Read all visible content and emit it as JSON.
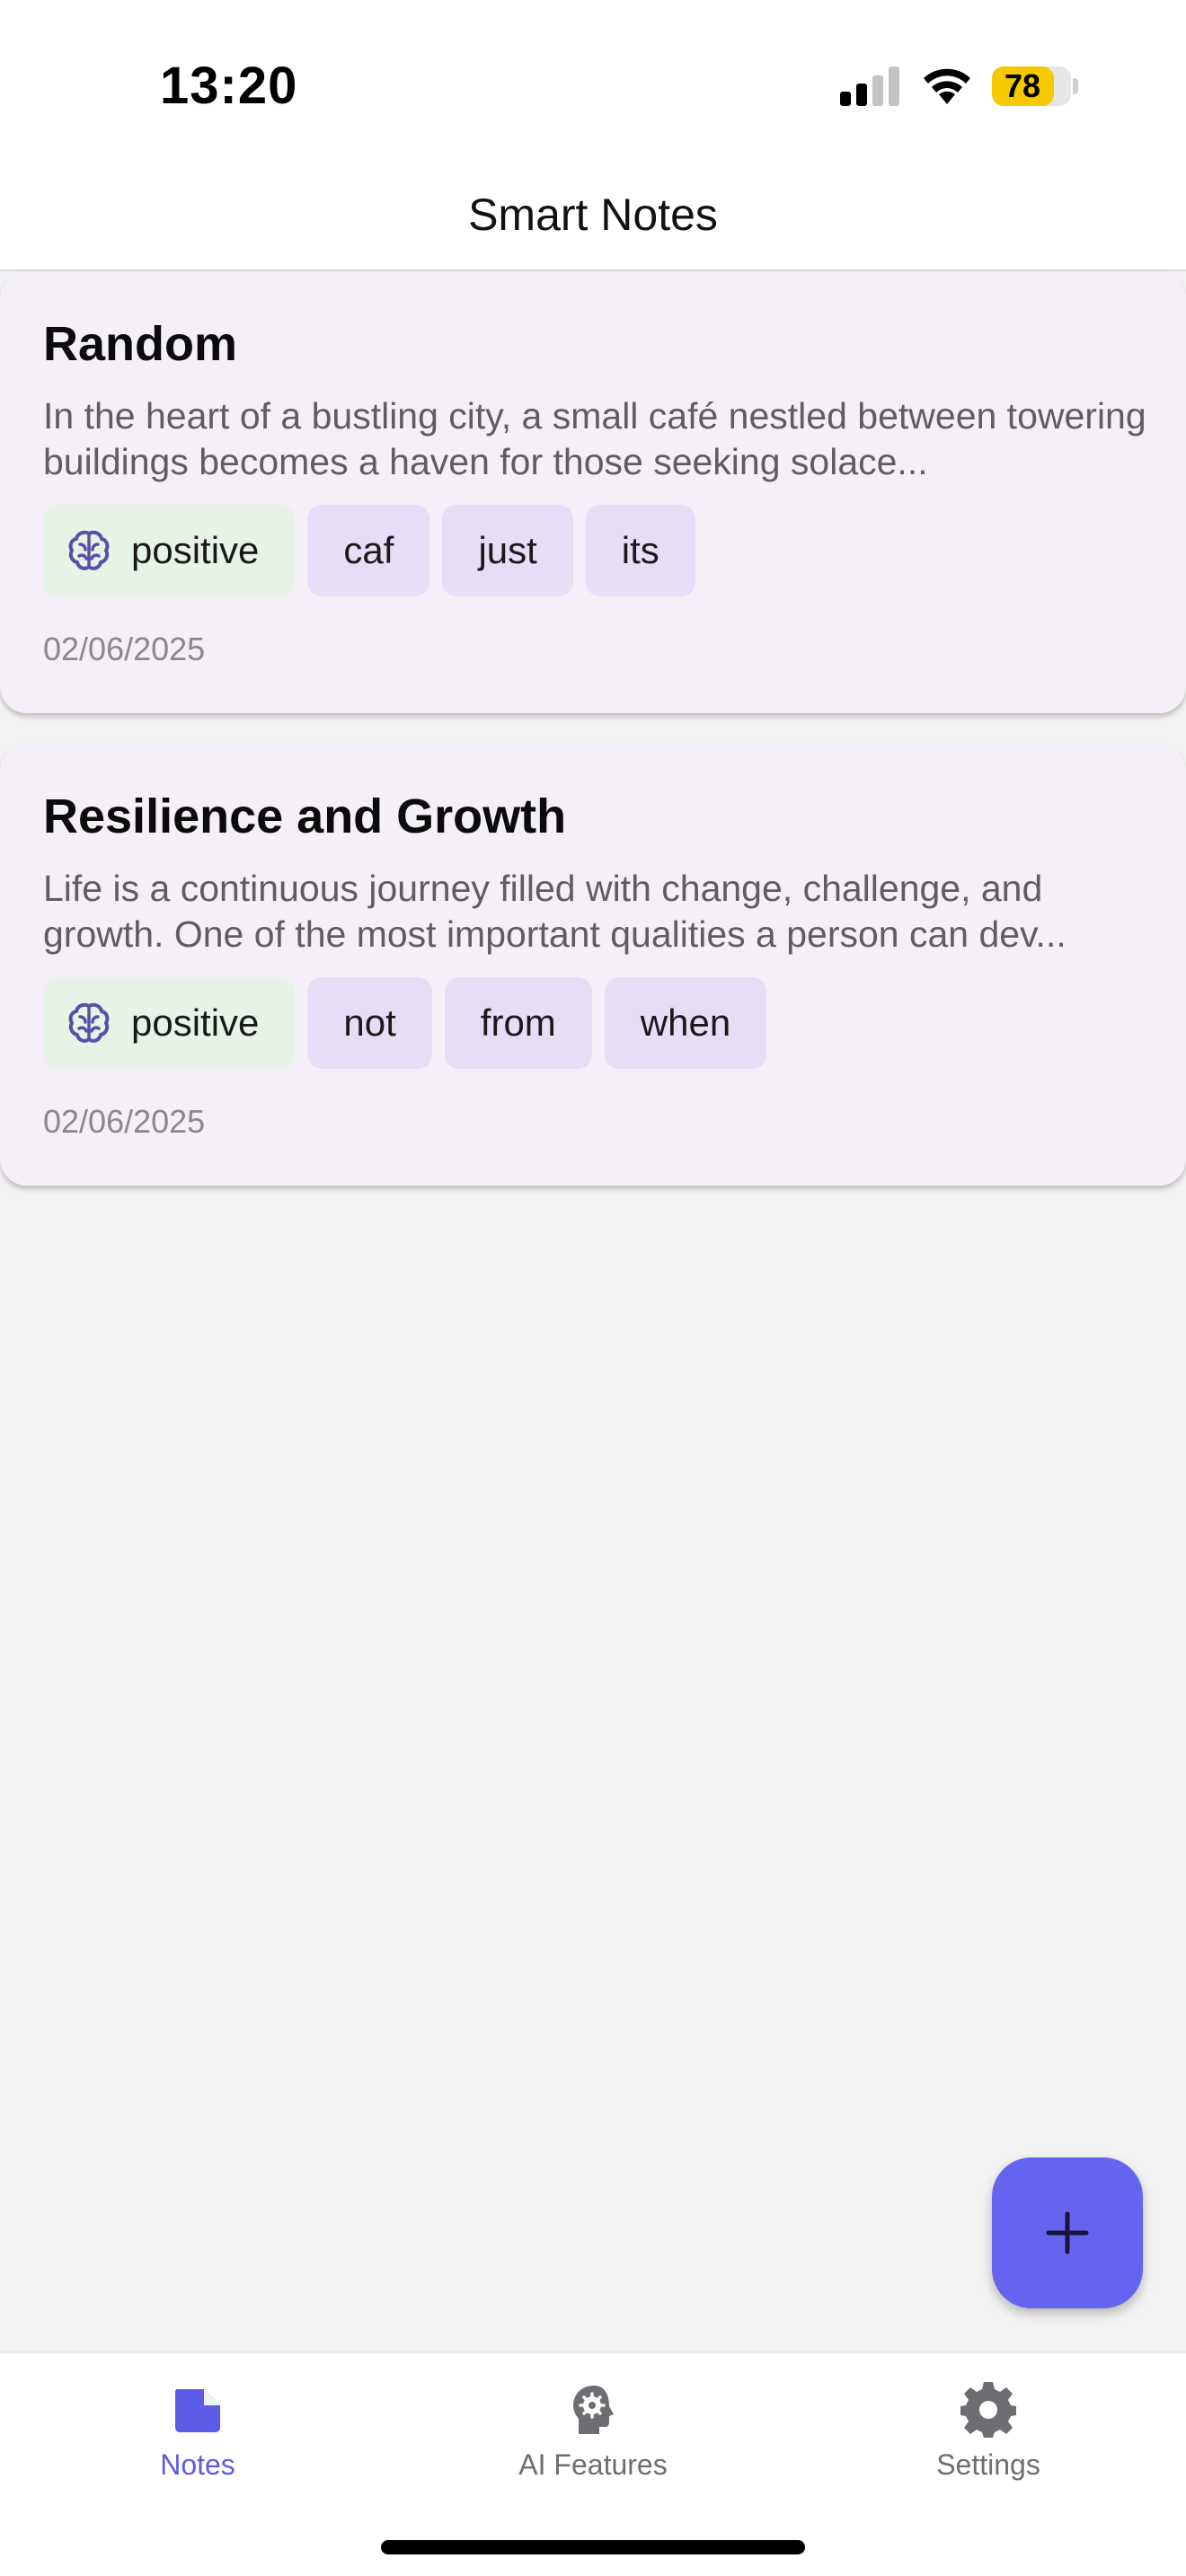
{
  "status_bar": {
    "time": "13:20",
    "battery": "78",
    "battery_level": 0.78,
    "icons": [
      "cellular-signal-icon",
      "wifi-icon",
      "battery-icon"
    ]
  },
  "app_bar": {
    "title": "Smart Notes"
  },
  "notes": [
    {
      "title": "Random",
      "body": "In the heart of a bustling city, a small café nestled between towering buildings becomes a haven for those seeking solace...",
      "sentiment": "positive",
      "keywords": [
        "caf",
        "just",
        "its"
      ],
      "date": "02/06/2025"
    },
    {
      "title": "Resilience and Growth",
      "body": "Life is a continuous journey filled with change, challenge, and growth. One of the most important qualities a person can dev...",
      "sentiment": "positive",
      "keywords": [
        "not",
        "from",
        "when"
      ],
      "date": "02/06/2025"
    }
  ],
  "fab": {
    "icon": "plus-icon"
  },
  "bottom_nav": {
    "items": [
      {
        "label": "Notes",
        "icon": "note-icon",
        "active": true
      },
      {
        "label": "AI Features",
        "icon": "ai-head-icon",
        "active": false
      },
      {
        "label": "Settings",
        "icon": "gear-icon",
        "active": false
      }
    ]
  },
  "colors": {
    "accent": "#6464f0",
    "card_background": "#f5f0f7",
    "keyword_chip": "#e6ddf6",
    "sentiment_chip": "#e8f3e8",
    "battery_yellow": "#f5c800",
    "inactive_nav": "#6e6e72",
    "active_nav": "#5b5be6"
  }
}
